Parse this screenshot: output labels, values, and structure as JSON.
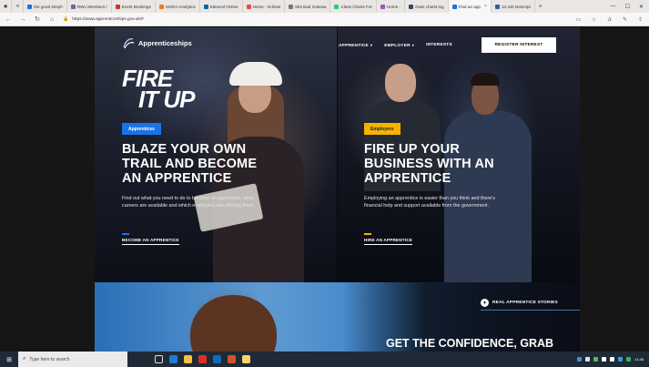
{
  "browser": {
    "tabs": [
      {
        "label": "the good sheph",
        "color": "#1a73e8"
      },
      {
        "label": "RWL Members /",
        "color": "#7b5ea7"
      },
      {
        "label": "Event Bookings",
        "color": "#c0392b"
      },
      {
        "label": "SISRA Analytics",
        "color": "#e67e22"
      },
      {
        "label": "Edexcel Online",
        "color": "#0064a7"
      },
      {
        "label": "Home - Itchiew",
        "color": "#e84c3d"
      },
      {
        "label": "502 Bad Gatewa",
        "color": "#777777"
      },
      {
        "label": "Class Charts For",
        "color": "#2ecc71"
      },
      {
        "label": "Home -",
        "color": "#9b59b6"
      },
      {
        "label": "class charts log",
        "color": "#34495e"
      },
      {
        "label": "Find an app",
        "color": "#1a73e8",
        "active": true
      },
      {
        "label": "13 Job Descript",
        "color": "#3b5998"
      }
    ],
    "url": "https://www.apprenticeships.gov.uk/#"
  },
  "site": {
    "logo_text": "Apprenticeships",
    "nav": [
      {
        "label": "APPRENTICE",
        "caret": "▾"
      },
      {
        "label": "EMPLOYER",
        "caret": "▾"
      },
      {
        "label": "INTERESTS",
        "caret": ""
      }
    ],
    "register_label": "REGISTER INTEREST",
    "fire_line1": "FIRE",
    "fire_line2": "IT UP"
  },
  "panels": {
    "left": {
      "badge": "Apprentices",
      "badge_color": "#1a73e8",
      "headline": "BLAZE YOUR OWN TRAIL AND BECOME AN APPRENTICE",
      "body": "Find out what you need to do to become an apprentice, what careers are available and which employers are offering them.",
      "cta": "BECOME AN APPRENTICE"
    },
    "right": {
      "badge": "Employers",
      "badge_color": "#f4b400",
      "headline": "FIRE UP YOUR BUSINESS WITH AN APPRENTICE",
      "body": "Employing an apprentice is easier than you think and there's financial help and support available from the government.",
      "cta": "HIRE AN APPRENTICE"
    }
  },
  "stories": {
    "tag": "REAL APPRENTICE STORIES",
    "headline": "GET THE CONFIDENCE, GRAB"
  },
  "taskbar": {
    "search_placeholder": "Type here to search",
    "clock": "11:48"
  }
}
